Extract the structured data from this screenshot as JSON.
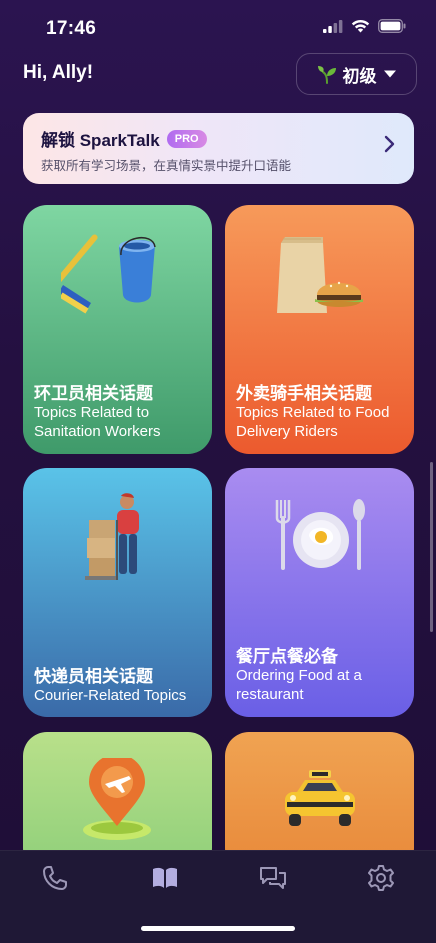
{
  "status_bar": {
    "time": "17:46"
  },
  "header": {
    "greeting": "Hi, Ally!",
    "level_label": "初级"
  },
  "pro_banner": {
    "title": "解锁 SparkTalk",
    "badge": "PRO",
    "subtitle": "获取所有学习场景，在真情实景中提升口语能"
  },
  "topics": [
    {
      "title_zh": "环卫员相关话题",
      "title_en": "Topics Related to Sanitation Workers",
      "color_top": "#7fd6a2",
      "color_bottom": "#3f9a6a",
      "illustration": "broom-bucket-icon"
    },
    {
      "title_zh": "外卖骑手相关话题",
      "title_en": "Topics Related to Food Delivery Riders",
      "color_top": "#f79a5a",
      "color_bottom": "#ec5a2e",
      "illustration": "food-bag-burger-icon"
    },
    {
      "title_zh": "快递员相关话题",
      "title_en": "Courier-Related Topics",
      "color_top": "#5ac3e8",
      "color_bottom": "#3a6aa8",
      "illustration": "courier-boxes-icon"
    },
    {
      "title_zh": "餐厅点餐必备",
      "title_en": "Ordering Food at a restaurant",
      "color_top": "#a98cf0",
      "color_bottom": "#6a5fe6",
      "illustration": "plate-cutlery-icon"
    },
    {
      "title_zh": "",
      "title_en": "",
      "color_top": "#b9e08a",
      "color_bottom": "#8fcf7a",
      "illustration": "airport-pin-icon"
    },
    {
      "title_zh": "",
      "title_en": "",
      "color_top": "#f0a352",
      "color_bottom": "#e8893a",
      "illustration": "taxi-icon"
    }
  ],
  "tab_bar": {
    "items": [
      "phone-icon",
      "book-icon",
      "chat-icon",
      "gear-icon"
    ],
    "active_index": 1
  }
}
